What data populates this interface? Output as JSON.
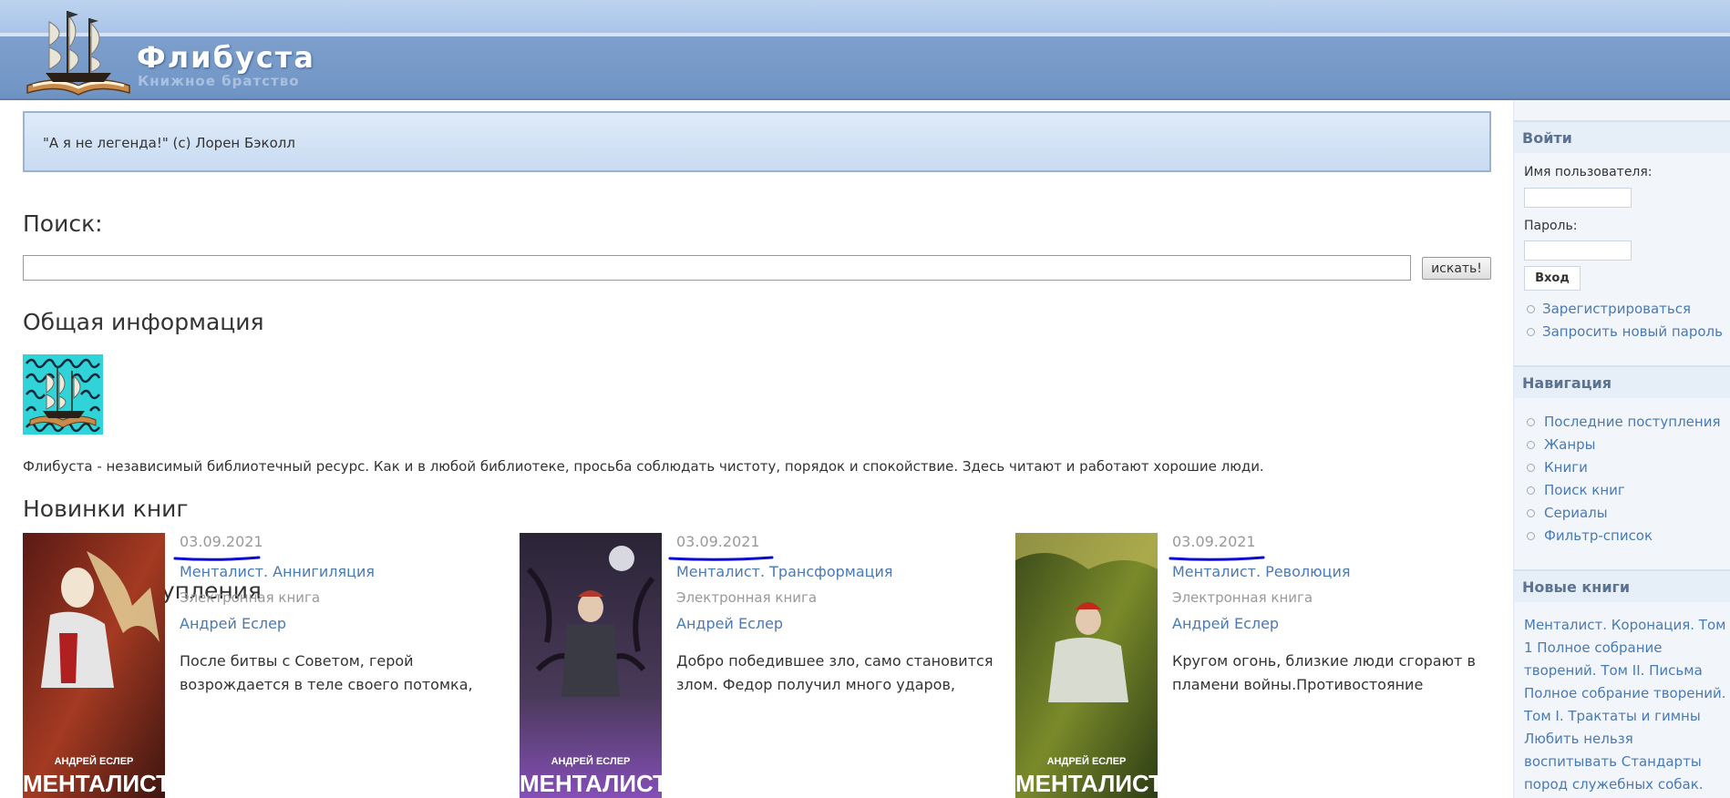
{
  "header": {
    "site_name": "Флибуста",
    "slogan": "Книжное братство"
  },
  "quote": "\"А я не легенда!\" (с) Лорен Бэколл",
  "search": {
    "heading": "Поиск:",
    "value": "",
    "button_label": "искать!"
  },
  "info": {
    "heading": "Общая информация",
    "text": "Флибуста - независимый библиотечный ресурс. Как и в любой библиотеке, просьба соблюдать чистоту, порядок и спокойствие. Здесь читают и работают хорошие люди."
  },
  "new_books_heading": "Новинки книг",
  "arrivals": {
    "heading": "Новые поступления",
    "books": [
      {
        "date": "03.09.2021",
        "title": "Менталист. Аннигиляция",
        "type": "Электронная книга",
        "author": "Андрей Еслер",
        "description": "После битвы с Советом, герой возрождается в теле своего потомка,",
        "cover_author": "АНДРЕЙ ЕСЛЕР",
        "cover_title": "МЕНТАЛИСТ"
      },
      {
        "date": "03.09.2021",
        "title": "Менталист. Трансформация",
        "type": "Электронная книга",
        "author": "Андрей Еслер",
        "description": "Добро победившее зло, само становится злом. Федор получил много ударов,",
        "cover_author": "АНДРЕЙ ЕСЛЕР",
        "cover_title": "МЕНТАЛИСТ"
      },
      {
        "date": "03.09.2021",
        "title": "Менталист. Революция",
        "type": "Электронная книга",
        "author": "Андрей Еслер",
        "description": "Кругом огонь, близкие люди сгорают в пламени войны.Противостояние",
        "cover_author": "АНДРЕЙ ЕСЛЕР",
        "cover_title": "МЕНТАЛИСТ"
      }
    ]
  },
  "sidebar": {
    "login": {
      "title": "Войти",
      "username_label": "Имя пользователя:",
      "password_label": "Пароль:",
      "submit_label": "Вход",
      "links": [
        "Зарегистрироваться",
        "Запросить новый пароль"
      ]
    },
    "navigation": {
      "title": "Навигация",
      "links": [
        "Последние поступления",
        "Жанры",
        "Книги",
        "Поиск книг",
        "Сериалы",
        "Фильтр-список"
      ]
    },
    "new_books": {
      "title": "Новые книги",
      "text": "Менталист. Коронация. Том 1 Полное собрание творений. Том II. Письма Полное собрание творений. Том I. Трактаты и гимны Любить нельзя воспитывать Стандарты пород служебных собак."
    }
  },
  "colors": {
    "link": "#4a7ab3",
    "header": "#7196c6",
    "annotation_underline": "#0a0ad0"
  }
}
